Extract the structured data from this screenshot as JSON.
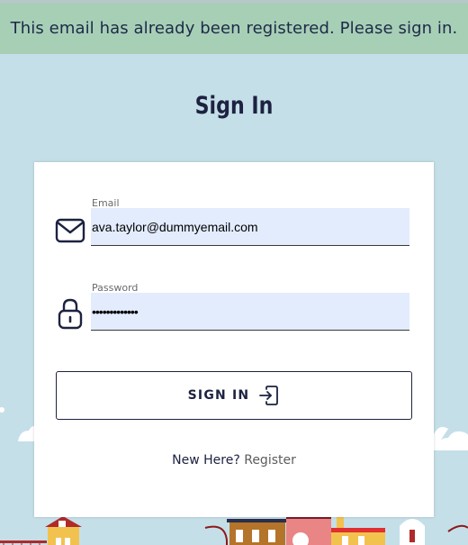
{
  "banner": {
    "message": "This email has already been registered. Please sign in."
  },
  "page": {
    "title": "Sign In"
  },
  "form": {
    "email": {
      "label": "Email",
      "value": "ava.taylor@dummyemail.com",
      "icon": "mail-icon"
    },
    "password": {
      "label": "Password",
      "value": "•••••••••••••",
      "icon": "lock-icon"
    },
    "submit": {
      "label": "SIGN IN",
      "icon": "sign-in-icon"
    }
  },
  "footer": {
    "prompt": "New Here?",
    "register_link": "Register"
  },
  "colors": {
    "background": "#c5dfe9",
    "banner": "#a7cfb6",
    "navy": "#1c2240",
    "input_fill": "#e3ecfd"
  }
}
